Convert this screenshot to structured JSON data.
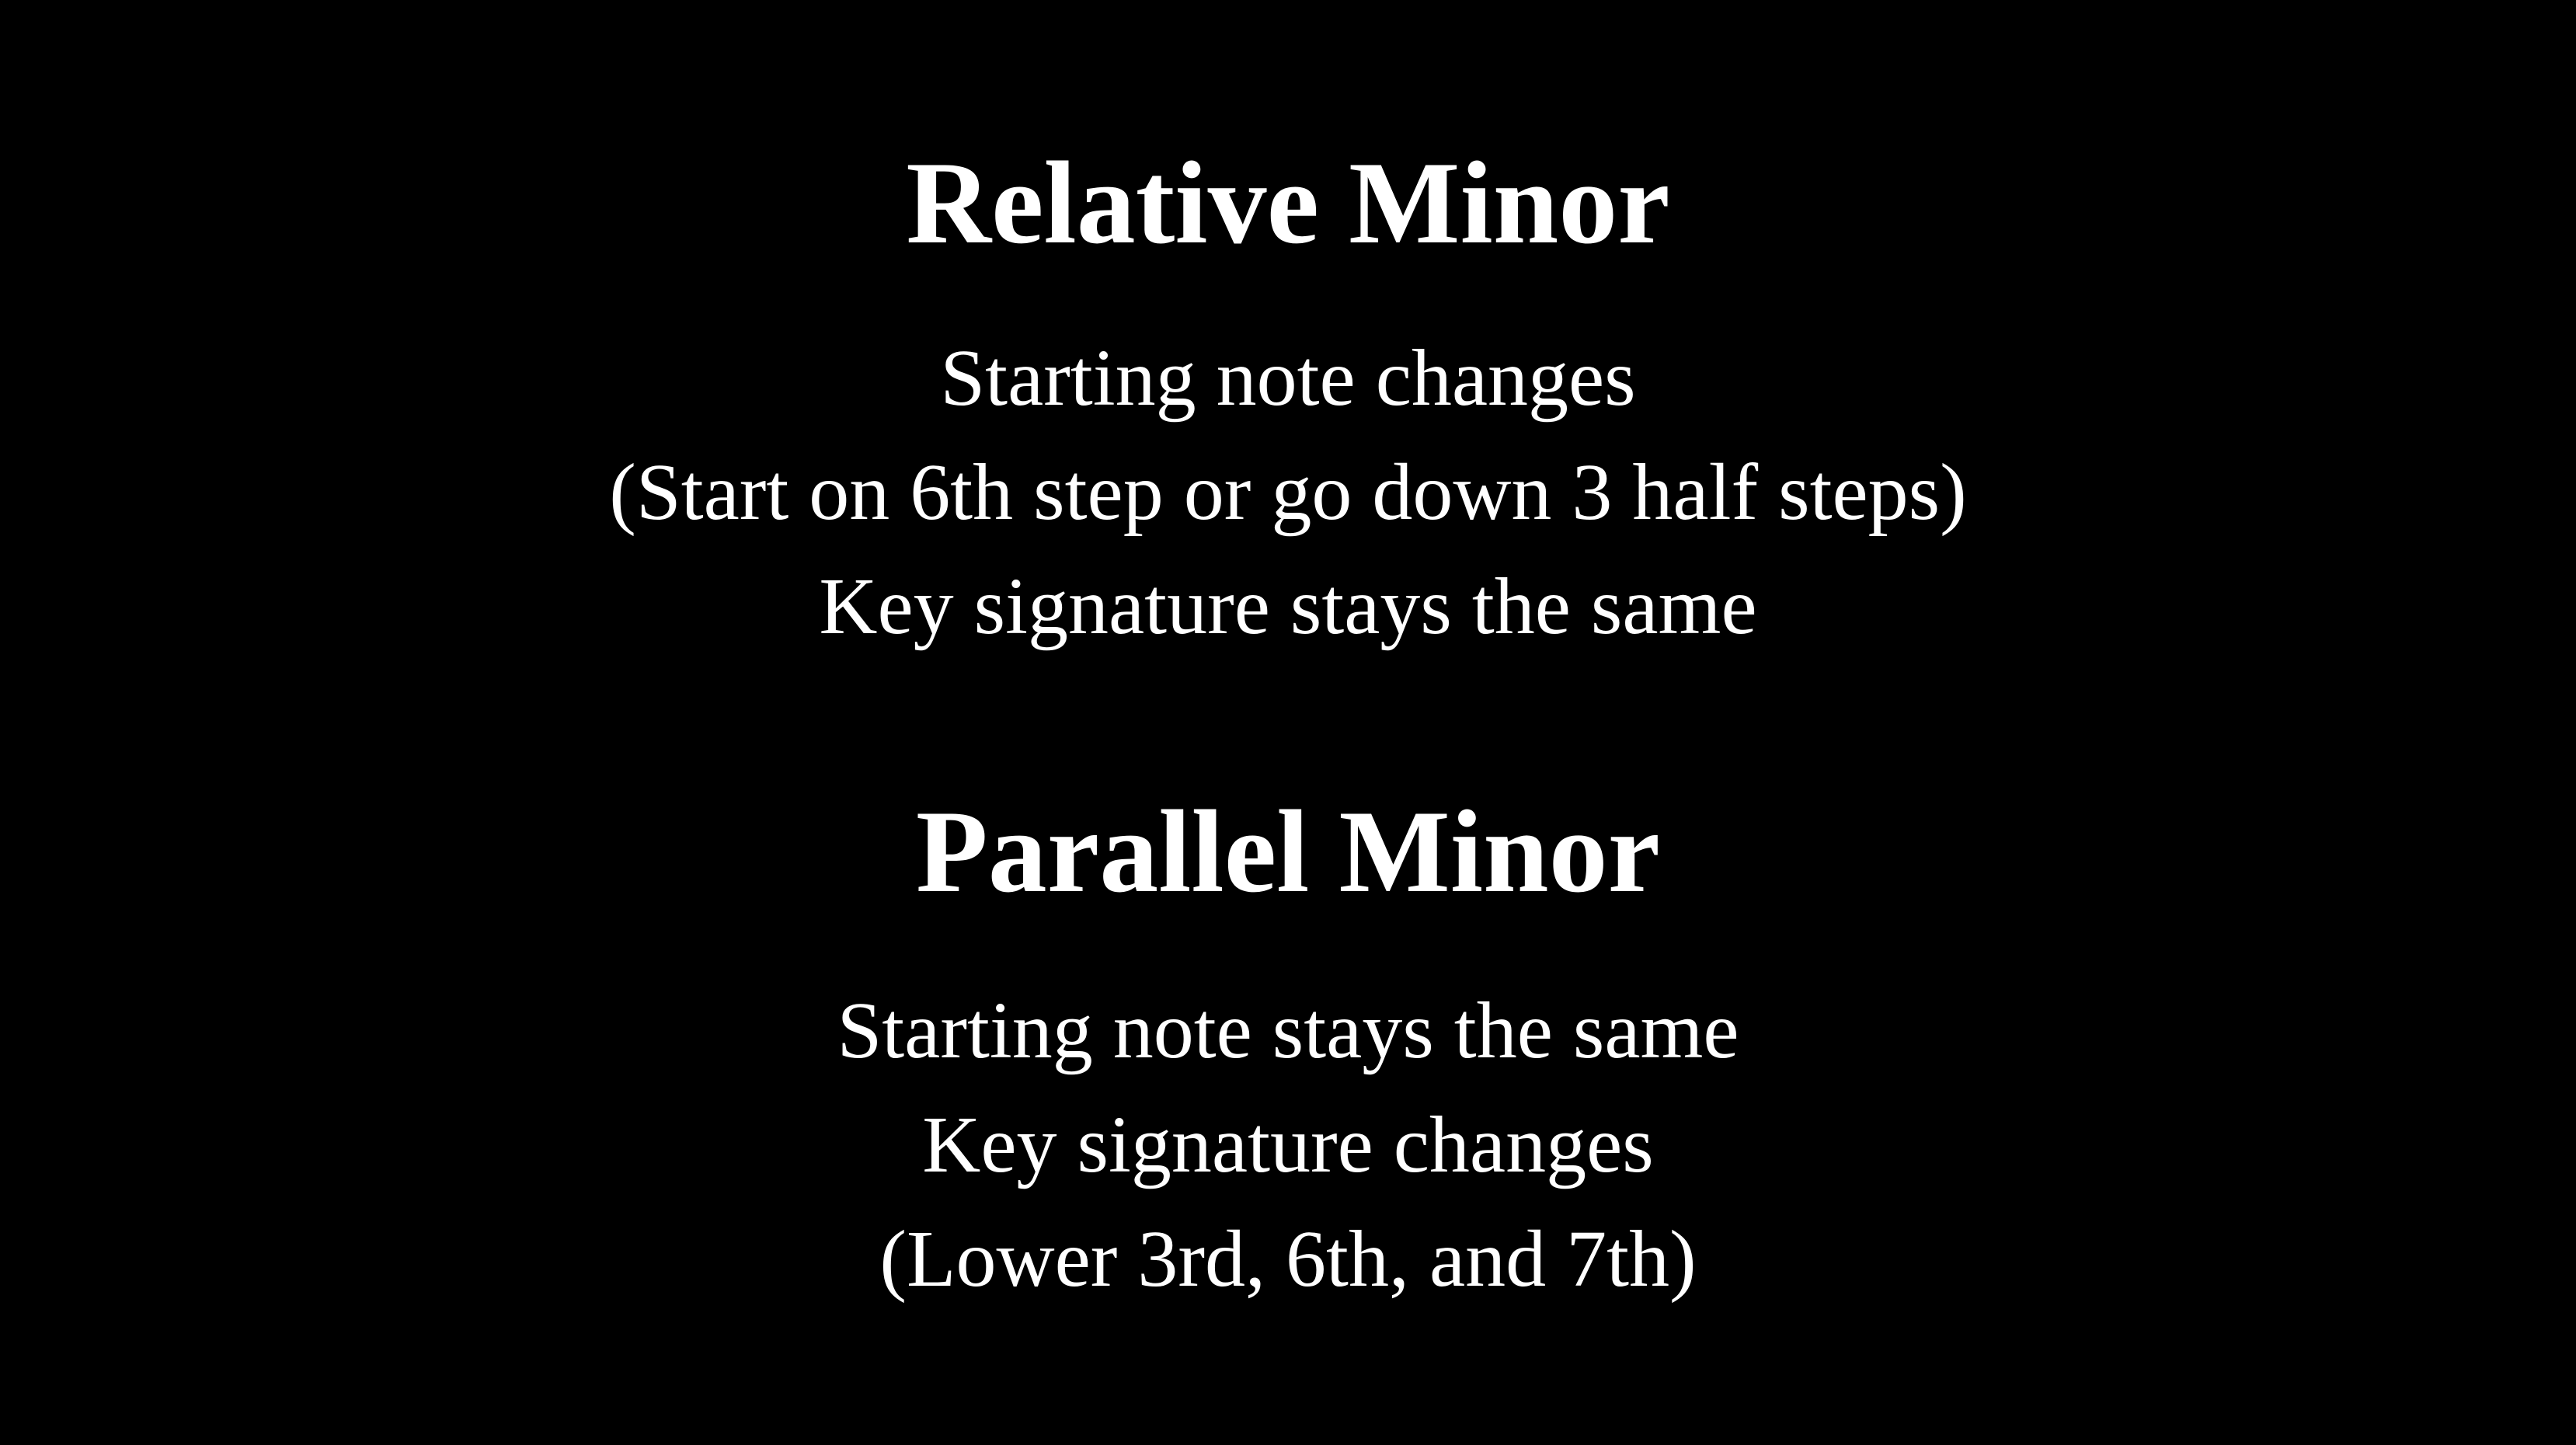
{
  "sections": [
    {
      "heading": "Relative Minor",
      "lines": [
        "Starting note changes",
        "(Start on 6th step or go down 3 half steps)",
        "Key signature stays the same"
      ]
    },
    {
      "heading": "Parallel Minor",
      "lines": [
        "Starting note stays the same",
        "Key signature changes",
        "(Lower 3rd, 6th, and 7th)"
      ]
    }
  ],
  "colors": {
    "background": "#000000",
    "text": "#ffffff"
  }
}
